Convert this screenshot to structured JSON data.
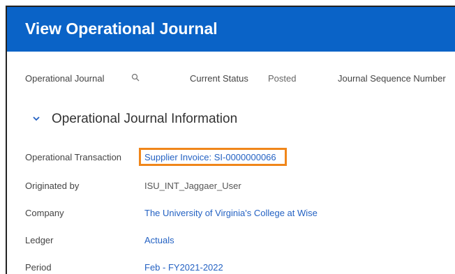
{
  "header": {
    "title": "View Operational Journal"
  },
  "status_bar": {
    "journal_label": "Operational Journal",
    "status_label": "Current Status",
    "status_value": "Posted",
    "sequence_label": "Journal Sequence Number"
  },
  "section": {
    "title": "Operational Journal Information"
  },
  "fields": [
    {
      "label": "Operational Transaction",
      "value": "Supplier Invoice: SI-0000000066"
    },
    {
      "label": "Originated by",
      "value": "ISU_INT_Jaggaer_User"
    },
    {
      "label": "Company",
      "value": "The University of Virginia's College at Wise"
    },
    {
      "label": "Ledger",
      "value": "Actuals"
    },
    {
      "label": "Period",
      "value": "Feb - FY2021-2022"
    }
  ],
  "colors": {
    "header_bg": "#0a63c7",
    "link": "#2462c3",
    "highlight": "#f0861a"
  }
}
